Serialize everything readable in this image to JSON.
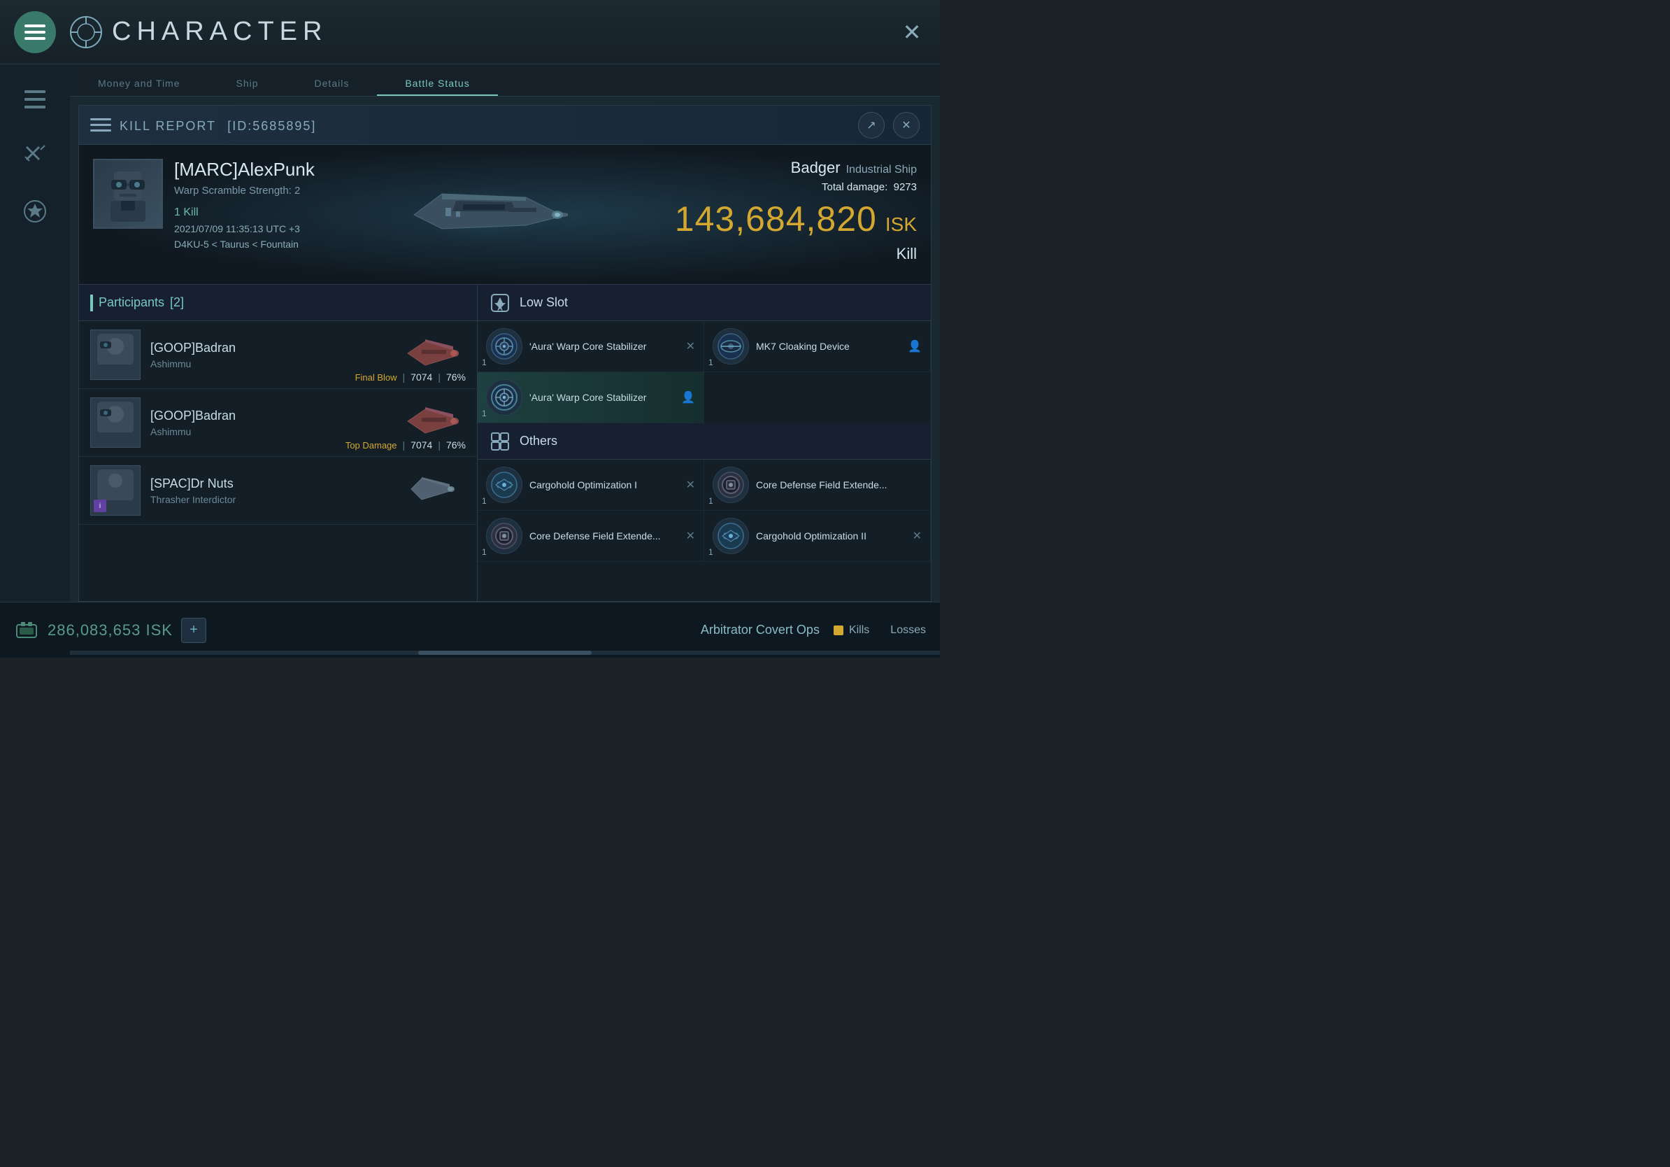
{
  "topBar": {
    "menuBtn": "☰",
    "titleIcon": "⊙",
    "title": "CHARACTER",
    "closeBtn": "✕"
  },
  "navTabs": [
    {
      "label": "Money and Time",
      "active": false
    },
    {
      "label": "Ship",
      "active": false
    },
    {
      "label": "Details",
      "active": false
    },
    {
      "label": "Battle Status",
      "active": false
    }
  ],
  "killReport": {
    "headerTitle": "KILL REPORT",
    "headerId": "[ID:5685895]",
    "exportBtnLabel": "↗",
    "closeBtnLabel": "✕",
    "character": {
      "name": "[MARC]AlexPunk",
      "stat": "Warp Scramble Strength: 2"
    },
    "killLabel": "1 Kill",
    "datetime": "2021/07/09 11:35:13 UTC +3",
    "location": "D4KU-5 < Taurus < Fountain",
    "shipInfo": {
      "name": "Badger",
      "class": "Industrial Ship",
      "totalDamageLabel": "Total damage:",
      "totalDamage": "9273",
      "isk": "143,684,820",
      "iskUnit": "ISK",
      "type": "Kill"
    },
    "participants": {
      "title": "Participants",
      "count": "[2]",
      "items": [
        {
          "name": "[GOOP]Badran",
          "corp": "Ashimmu",
          "blowLabel": "Final Blow",
          "damage": "7074",
          "percent": "76%"
        },
        {
          "name": "[GOOP]Badran",
          "corp": "Ashimmu",
          "blowLabel": "Top Damage",
          "damage": "7074",
          "percent": "76%"
        },
        {
          "name": "[SPAC]Dr Nuts",
          "corp": "Thrasher Interdictor",
          "blowLabel": "",
          "damage": "",
          "percent": ""
        }
      ]
    },
    "lowSlot": {
      "title": "Low Slot",
      "items": [
        {
          "name": "'Aura' Warp Core Stabilizer",
          "qty": "1",
          "hasX": true,
          "hasPerson": false,
          "highlighted": false
        },
        {
          "name": "MK7 Cloaking Device",
          "qty": "1",
          "hasX": false,
          "hasPerson": true,
          "highlighted": false
        },
        {
          "name": "'Aura' Warp Core Stabilizer",
          "qty": "1",
          "hasX": false,
          "hasPerson": true,
          "highlighted": true
        }
      ]
    },
    "others": {
      "title": "Others",
      "items": [
        {
          "name": "Cargohold Optimization I",
          "qty": "1",
          "hasX": true,
          "hasPerson": false
        },
        {
          "name": "Core Defense Field Extende...",
          "qty": "1",
          "hasX": false,
          "hasPerson": false
        },
        {
          "name": "Core Defense Field Extende...",
          "qty": "1",
          "hasX": true,
          "hasPerson": false
        },
        {
          "name": "Cargohold Optimization II",
          "qty": "1",
          "hasX": true,
          "hasPerson": false
        }
      ]
    }
  },
  "bottomBar": {
    "isk": "286,083,653 ISK",
    "plusLabel": "+",
    "shipName": "Arbitrator Covert Ops",
    "kills": "Kills",
    "losses": "Losses"
  },
  "icons": {
    "menu": "☰",
    "close": "✕",
    "shield": "🛡",
    "box": "📦",
    "export": "↗",
    "star": "★",
    "swords": "⚔"
  }
}
